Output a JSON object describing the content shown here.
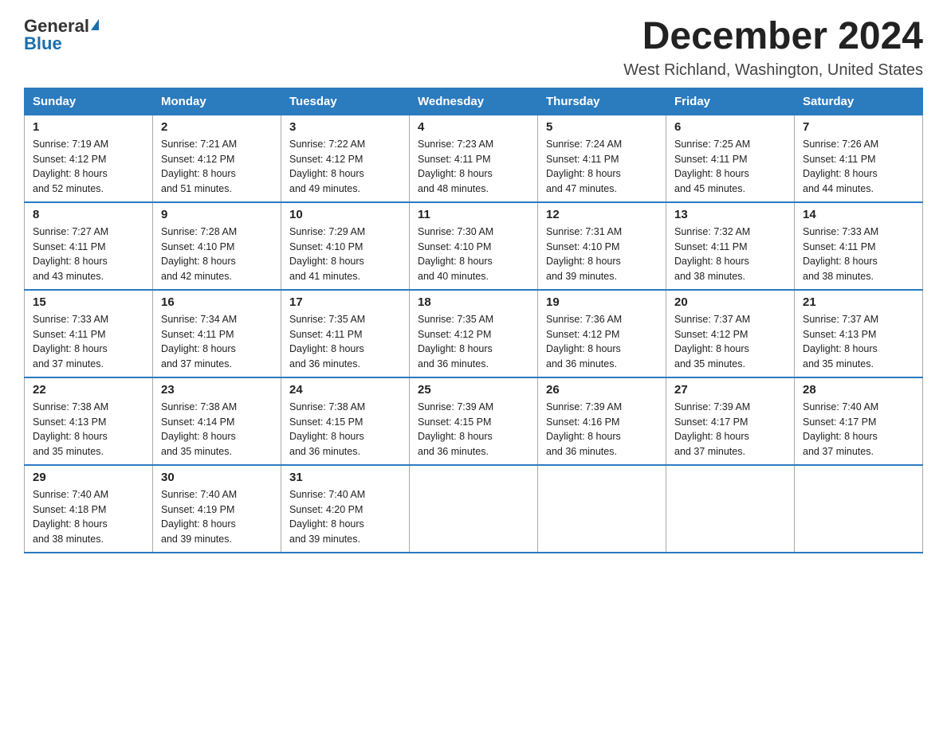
{
  "header": {
    "logo_general": "General",
    "logo_blue": "Blue",
    "month_year": "December 2024",
    "location": "West Richland, Washington, United States"
  },
  "days_of_week": [
    "Sunday",
    "Monday",
    "Tuesday",
    "Wednesday",
    "Thursday",
    "Friday",
    "Saturday"
  ],
  "weeks": [
    [
      {
        "day": "1",
        "sunrise": "7:19 AM",
        "sunset": "4:12 PM",
        "daylight": "8 hours and 52 minutes."
      },
      {
        "day": "2",
        "sunrise": "7:21 AM",
        "sunset": "4:12 PM",
        "daylight": "8 hours and 51 minutes."
      },
      {
        "day": "3",
        "sunrise": "7:22 AM",
        "sunset": "4:12 PM",
        "daylight": "8 hours and 49 minutes."
      },
      {
        "day": "4",
        "sunrise": "7:23 AM",
        "sunset": "4:11 PM",
        "daylight": "8 hours and 48 minutes."
      },
      {
        "day": "5",
        "sunrise": "7:24 AM",
        "sunset": "4:11 PM",
        "daylight": "8 hours and 47 minutes."
      },
      {
        "day": "6",
        "sunrise": "7:25 AM",
        "sunset": "4:11 PM",
        "daylight": "8 hours and 45 minutes."
      },
      {
        "day": "7",
        "sunrise": "7:26 AM",
        "sunset": "4:11 PM",
        "daylight": "8 hours and 44 minutes."
      }
    ],
    [
      {
        "day": "8",
        "sunrise": "7:27 AM",
        "sunset": "4:11 PM",
        "daylight": "8 hours and 43 minutes."
      },
      {
        "day": "9",
        "sunrise": "7:28 AM",
        "sunset": "4:10 PM",
        "daylight": "8 hours and 42 minutes."
      },
      {
        "day": "10",
        "sunrise": "7:29 AM",
        "sunset": "4:10 PM",
        "daylight": "8 hours and 41 minutes."
      },
      {
        "day": "11",
        "sunrise": "7:30 AM",
        "sunset": "4:10 PM",
        "daylight": "8 hours and 40 minutes."
      },
      {
        "day": "12",
        "sunrise": "7:31 AM",
        "sunset": "4:10 PM",
        "daylight": "8 hours and 39 minutes."
      },
      {
        "day": "13",
        "sunrise": "7:32 AM",
        "sunset": "4:11 PM",
        "daylight": "8 hours and 38 minutes."
      },
      {
        "day": "14",
        "sunrise": "7:33 AM",
        "sunset": "4:11 PM",
        "daylight": "8 hours and 38 minutes."
      }
    ],
    [
      {
        "day": "15",
        "sunrise": "7:33 AM",
        "sunset": "4:11 PM",
        "daylight": "8 hours and 37 minutes."
      },
      {
        "day": "16",
        "sunrise": "7:34 AM",
        "sunset": "4:11 PM",
        "daylight": "8 hours and 37 minutes."
      },
      {
        "day": "17",
        "sunrise": "7:35 AM",
        "sunset": "4:11 PM",
        "daylight": "8 hours and 36 minutes."
      },
      {
        "day": "18",
        "sunrise": "7:35 AM",
        "sunset": "4:12 PM",
        "daylight": "8 hours and 36 minutes."
      },
      {
        "day": "19",
        "sunrise": "7:36 AM",
        "sunset": "4:12 PM",
        "daylight": "8 hours and 36 minutes."
      },
      {
        "day": "20",
        "sunrise": "7:37 AM",
        "sunset": "4:12 PM",
        "daylight": "8 hours and 35 minutes."
      },
      {
        "day": "21",
        "sunrise": "7:37 AM",
        "sunset": "4:13 PM",
        "daylight": "8 hours and 35 minutes."
      }
    ],
    [
      {
        "day": "22",
        "sunrise": "7:38 AM",
        "sunset": "4:13 PM",
        "daylight": "8 hours and 35 minutes."
      },
      {
        "day": "23",
        "sunrise": "7:38 AM",
        "sunset": "4:14 PM",
        "daylight": "8 hours and 35 minutes."
      },
      {
        "day": "24",
        "sunrise": "7:38 AM",
        "sunset": "4:15 PM",
        "daylight": "8 hours and 36 minutes."
      },
      {
        "day": "25",
        "sunrise": "7:39 AM",
        "sunset": "4:15 PM",
        "daylight": "8 hours and 36 minutes."
      },
      {
        "day": "26",
        "sunrise": "7:39 AM",
        "sunset": "4:16 PM",
        "daylight": "8 hours and 36 minutes."
      },
      {
        "day": "27",
        "sunrise": "7:39 AM",
        "sunset": "4:17 PM",
        "daylight": "8 hours and 37 minutes."
      },
      {
        "day": "28",
        "sunrise": "7:40 AM",
        "sunset": "4:17 PM",
        "daylight": "8 hours and 37 minutes."
      }
    ],
    [
      {
        "day": "29",
        "sunrise": "7:40 AM",
        "sunset": "4:18 PM",
        "daylight": "8 hours and 38 minutes."
      },
      {
        "day": "30",
        "sunrise": "7:40 AM",
        "sunset": "4:19 PM",
        "daylight": "8 hours and 39 minutes."
      },
      {
        "day": "31",
        "sunrise": "7:40 AM",
        "sunset": "4:20 PM",
        "daylight": "8 hours and 39 minutes."
      },
      null,
      null,
      null,
      null
    ]
  ],
  "labels": {
    "sunrise": "Sunrise:",
    "sunset": "Sunset:",
    "daylight": "Daylight:"
  }
}
